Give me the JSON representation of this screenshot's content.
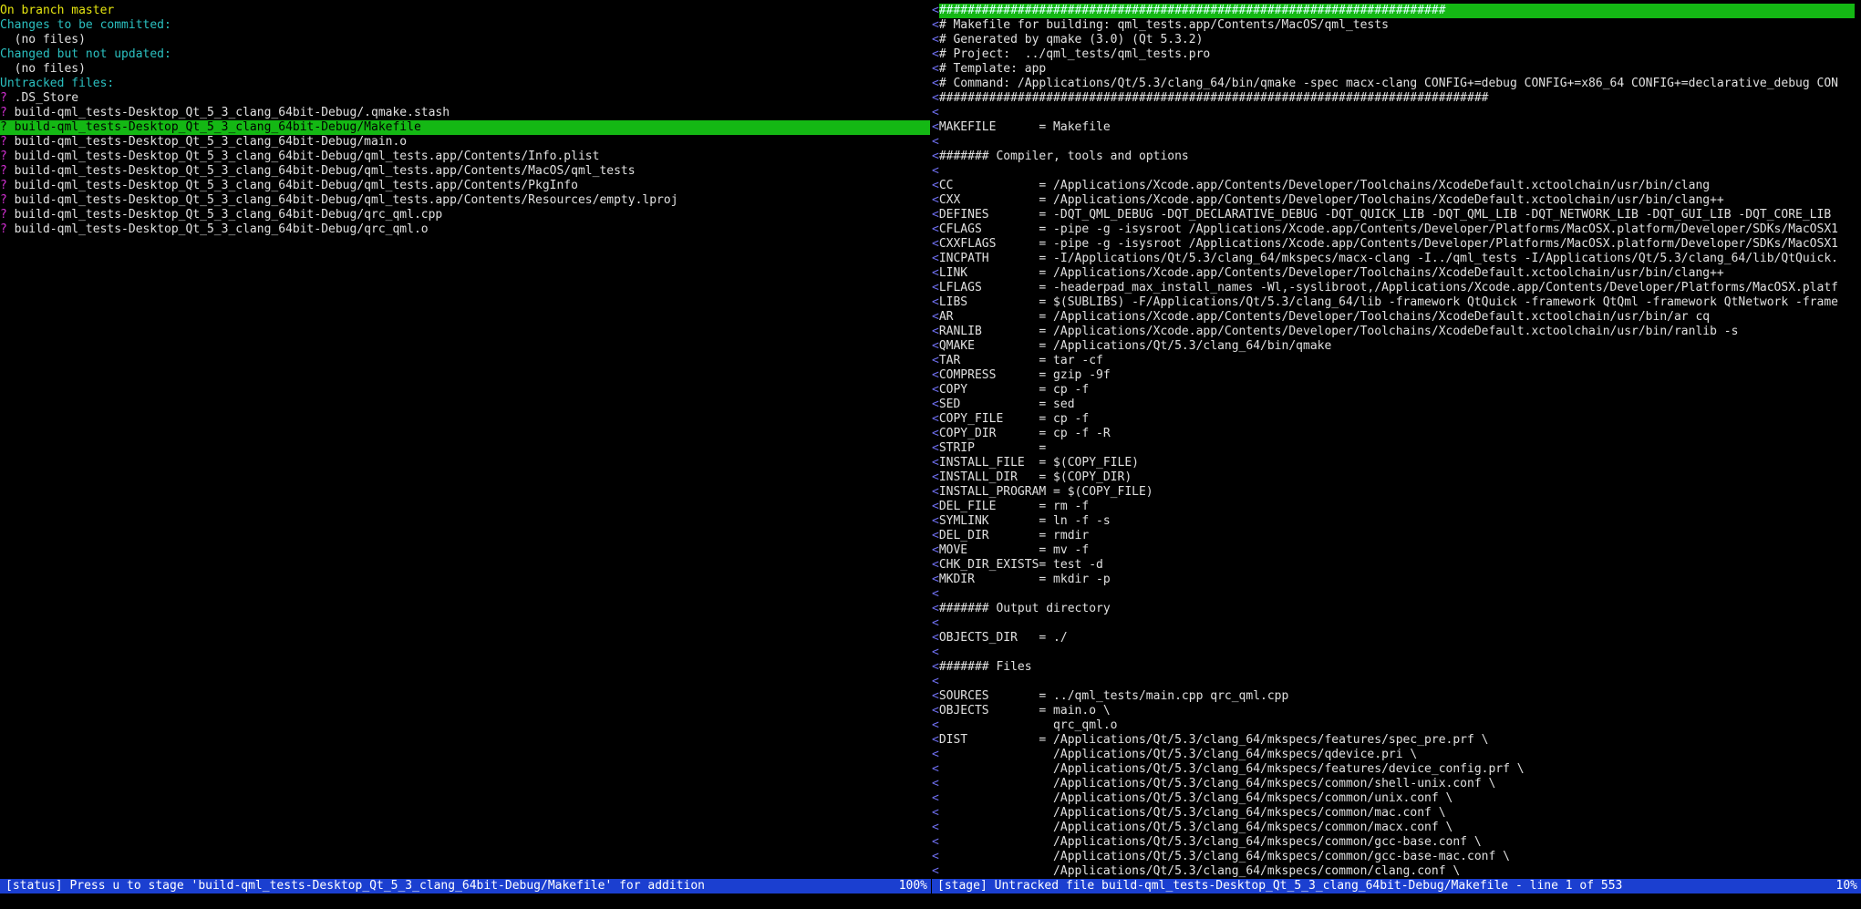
{
  "status_pane": {
    "lines": [
      {
        "kind": "header-yellow",
        "text": "On branch master"
      },
      {
        "kind": "header-cyan",
        "text": "Changes to be committed:"
      },
      {
        "kind": "plain",
        "text": "  (no files)"
      },
      {
        "kind": "header-cyan",
        "text": "Changed but not updated:"
      },
      {
        "kind": "plain",
        "text": "  (no files)"
      },
      {
        "kind": "header-cyan",
        "text": "Untracked files:"
      },
      {
        "kind": "file",
        "mark": "?",
        "text": " .DS_Store"
      },
      {
        "kind": "file",
        "mark": "?",
        "text": " build-qml_tests-Desktop_Qt_5_3_clang_64bit-Debug/.qmake.stash"
      },
      {
        "kind": "selected",
        "mark": "?",
        "text": " build-qml_tests-Desktop_Qt_5_3_clang_64bit-Debug/Makefile"
      },
      {
        "kind": "file",
        "mark": "?",
        "text": " build-qml_tests-Desktop_Qt_5_3_clang_64bit-Debug/main.o"
      },
      {
        "kind": "file",
        "mark": "?",
        "text": " build-qml_tests-Desktop_Qt_5_3_clang_64bit-Debug/qml_tests.app/Contents/Info.plist"
      },
      {
        "kind": "file",
        "mark": "?",
        "text": " build-qml_tests-Desktop_Qt_5_3_clang_64bit-Debug/qml_tests.app/Contents/MacOS/qml_tests"
      },
      {
        "kind": "file",
        "mark": "?",
        "text": " build-qml_tests-Desktop_Qt_5_3_clang_64bit-Debug/qml_tests.app/Contents/PkgInfo"
      },
      {
        "kind": "file",
        "mark": "?",
        "text": " build-qml_tests-Desktop_Qt_5_3_clang_64bit-Debug/qml_tests.app/Contents/Resources/empty.lproj"
      },
      {
        "kind": "file",
        "mark": "?",
        "text": " build-qml_tests-Desktop_Qt_5_3_clang_64bit-Debug/qrc_qml.cpp"
      },
      {
        "kind": "file",
        "mark": "?",
        "text": " build-qml_tests-Desktop_Qt_5_3_clang_64bit-Debug/qrc_qml.o"
      }
    ]
  },
  "stage_pane": {
    "gutter_marker": "<",
    "lines": [
      {
        "kind": "hashbar",
        "text": "#######################################################################"
      },
      {
        "text": "# Makefile for building: qml_tests.app/Contents/MacOS/qml_tests"
      },
      {
        "text": "# Generated by qmake (3.0) (Qt 5.3.2)"
      },
      {
        "text": "# Project:  ../qml_tests/qml_tests.pro"
      },
      {
        "text": "# Template: app"
      },
      {
        "text": "# Command: /Applications/Qt/5.3/clang_64/bin/qmake -spec macx-clang CONFIG+=debug CONFIG+=x86_64 CONFIG+=declarative_debug CON"
      },
      {
        "text": "#############################################################################"
      },
      {
        "text": ""
      },
      {
        "text": "MAKEFILE      = Makefile"
      },
      {
        "text": ""
      },
      {
        "text": "####### Compiler, tools and options"
      },
      {
        "text": ""
      },
      {
        "text": "CC            = /Applications/Xcode.app/Contents/Developer/Toolchains/XcodeDefault.xctoolchain/usr/bin/clang"
      },
      {
        "text": "CXX           = /Applications/Xcode.app/Contents/Developer/Toolchains/XcodeDefault.xctoolchain/usr/bin/clang++"
      },
      {
        "text": "DEFINES       = -DQT_QML_DEBUG -DQT_DECLARATIVE_DEBUG -DQT_QUICK_LIB -DQT_QML_LIB -DQT_NETWORK_LIB -DQT_GUI_LIB -DQT_CORE_LIB"
      },
      {
        "text": "CFLAGS        = -pipe -g -isysroot /Applications/Xcode.app/Contents/Developer/Platforms/MacOSX.platform/Developer/SDKs/MacOSX1"
      },
      {
        "text": "CXXFLAGS      = -pipe -g -isysroot /Applications/Xcode.app/Contents/Developer/Platforms/MacOSX.platform/Developer/SDKs/MacOSX1"
      },
      {
        "text": "INCPATH       = -I/Applications/Qt/5.3/clang_64/mkspecs/macx-clang -I../qml_tests -I/Applications/Qt/5.3/clang_64/lib/QtQuick."
      },
      {
        "text": "LINK          = /Applications/Xcode.app/Contents/Developer/Toolchains/XcodeDefault.xctoolchain/usr/bin/clang++"
      },
      {
        "text": "LFLAGS        = -headerpad_max_install_names -Wl,-syslibroot,/Applications/Xcode.app/Contents/Developer/Platforms/MacOSX.platf"
      },
      {
        "text": "LIBS          = $(SUBLIBS) -F/Applications/Qt/5.3/clang_64/lib -framework QtQuick -framework QtQml -framework QtNetwork -frame"
      },
      {
        "text": "AR            = /Applications/Xcode.app/Contents/Developer/Toolchains/XcodeDefault.xctoolchain/usr/bin/ar cq"
      },
      {
        "text": "RANLIB        = /Applications/Xcode.app/Contents/Developer/Toolchains/XcodeDefault.xctoolchain/usr/bin/ranlib -s"
      },
      {
        "text": "QMAKE         = /Applications/Qt/5.3/clang_64/bin/qmake"
      },
      {
        "text": "TAR           = tar -cf"
      },
      {
        "text": "COMPRESS      = gzip -9f"
      },
      {
        "text": "COPY          = cp -f"
      },
      {
        "text": "SED           = sed"
      },
      {
        "text": "COPY_FILE     = cp -f"
      },
      {
        "text": "COPY_DIR      = cp -f -R"
      },
      {
        "text": "STRIP         ="
      },
      {
        "text": "INSTALL_FILE  = $(COPY_FILE)"
      },
      {
        "text": "INSTALL_DIR   = $(COPY_DIR)"
      },
      {
        "text": "INSTALL_PROGRAM = $(COPY_FILE)"
      },
      {
        "text": "DEL_FILE      = rm -f"
      },
      {
        "text": "SYMLINK       = ln -f -s"
      },
      {
        "text": "DEL_DIR       = rmdir"
      },
      {
        "text": "MOVE          = mv -f"
      },
      {
        "text": "CHK_DIR_EXISTS= test -d"
      },
      {
        "text": "MKDIR         = mkdir -p"
      },
      {
        "text": ""
      },
      {
        "text": "####### Output directory"
      },
      {
        "text": ""
      },
      {
        "text": "OBJECTS_DIR   = ./"
      },
      {
        "text": ""
      },
      {
        "text": "####### Files"
      },
      {
        "text": ""
      },
      {
        "text": "SOURCES       = ../qml_tests/main.cpp qrc_qml.cpp"
      },
      {
        "text": "OBJECTS       = main.o \\"
      },
      {
        "text": "                qrc_qml.o"
      },
      {
        "text": "DIST          = /Applications/Qt/5.3/clang_64/mkspecs/features/spec_pre.prf \\"
      },
      {
        "text": "                /Applications/Qt/5.3/clang_64/mkspecs/qdevice.pri \\"
      },
      {
        "text": "                /Applications/Qt/5.3/clang_64/mkspecs/features/device_config.prf \\"
      },
      {
        "text": "                /Applications/Qt/5.3/clang_64/mkspecs/common/shell-unix.conf \\"
      },
      {
        "text": "                /Applications/Qt/5.3/clang_64/mkspecs/common/unix.conf \\"
      },
      {
        "text": "                /Applications/Qt/5.3/clang_64/mkspecs/common/mac.conf \\"
      },
      {
        "text": "                /Applications/Qt/5.3/clang_64/mkspecs/common/macx.conf \\"
      },
      {
        "text": "                /Applications/Qt/5.3/clang_64/mkspecs/common/gcc-base.conf \\"
      },
      {
        "text": "                /Applications/Qt/5.3/clang_64/mkspecs/common/gcc-base-mac.conf \\"
      },
      {
        "text": "                /Applications/Qt/5.3/clang_64/mkspecs/common/clang.conf \\"
      }
    ]
  },
  "statusbar_left": {
    "text": "[status] Press u to stage 'build-qml_tests-Desktop_Qt_5_3_clang_64bit-Debug/Makefile' for addition",
    "percent": "100%"
  },
  "statusbar_right": {
    "text": "[stage] Untracked file build-qml_tests-Desktop_Qt_5_3_clang_64bit-Debug/Makefile - line 1 of 553",
    "percent": "10%"
  },
  "colors": {
    "background": "#000000",
    "selection": "#14b814",
    "statusbar": "#1b3fd0",
    "header_yellow": "#e5e510",
    "header_cyan": "#2bc0c0",
    "untracked_marker": "#d12fd1"
  }
}
